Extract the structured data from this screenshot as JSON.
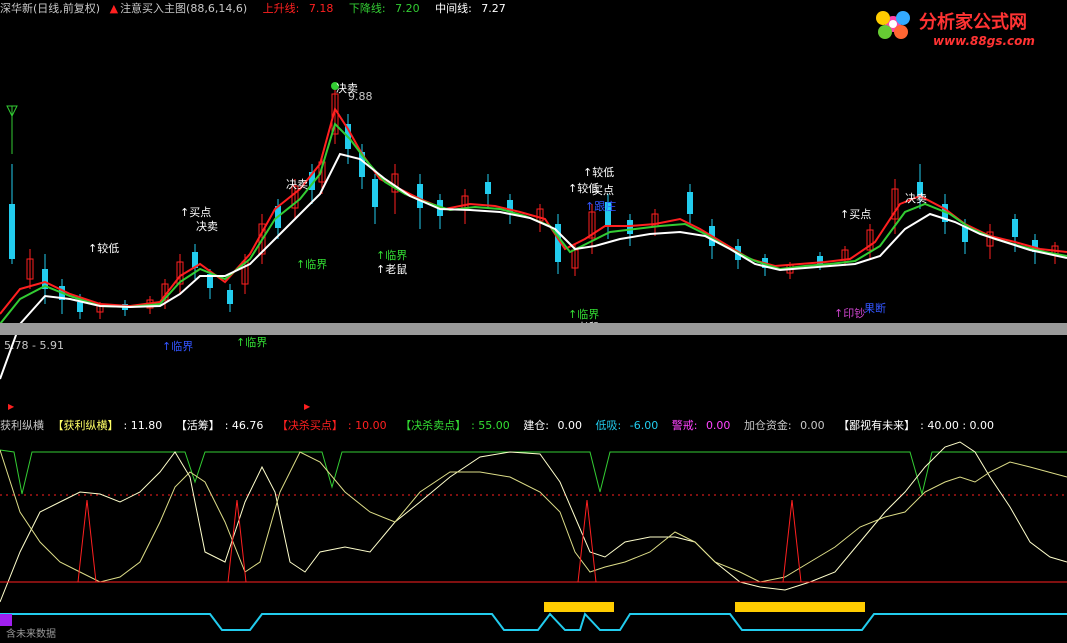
{
  "header": {
    "stock": "深华新(日线,前复权)",
    "indicator": "注意买入主图(88,6,14,6)",
    "up_label": "上升线:",
    "up_value": "7.18",
    "down_label": "下降线:",
    "down_value": "7.20",
    "mid_label": "中间线:",
    "mid_value": "7.27"
  },
  "logo": {
    "title": "分析家公式网",
    "url": "www.88gs.com"
  },
  "main_chart": {
    "price_high_label": "9.88",
    "price_low_label": "5.78 - 5.91",
    "signals": [
      {
        "text": "↑较低",
        "color": "#ffffff"
      },
      {
        "text": "↑买点",
        "color": "#ffffff"
      },
      {
        "text": "决卖",
        "color": "#ffffff"
      },
      {
        "text": "↑临界",
        "color": "#33dd33"
      },
      {
        "text": "↑临界",
        "color": "#33dd33"
      },
      {
        "text": "↑临界",
        "color": "#33dd33"
      },
      {
        "text": "↑老鼠",
        "color": "#ffffff"
      },
      {
        "text": "↑临界",
        "color": "#33dd33"
      },
      {
        "text": "↑老鼠",
        "color": "#ffffff"
      },
      {
        "text": "↑较低",
        "color": "#ffffff"
      },
      {
        "text": "↑较低",
        "color": "#ffffff"
      },
      {
        "text": "买点",
        "color": "#ffffff"
      },
      {
        "text": "↑买点",
        "color": "#ffffff"
      },
      {
        "text": "↑印钞",
        "color": "#cc44cc"
      },
      {
        "text": "果断",
        "color": "#3355ff"
      },
      {
        "text": "决卖",
        "color": "#ffffff"
      },
      {
        "text": "决卖",
        "color": "#ffffff"
      },
      {
        "text": "↑跟庄",
        "color": "#3355ff"
      },
      {
        "text": "↑临界",
        "color": "#3355ff"
      },
      {
        "text": "决卖",
        "color": "#ffffff"
      }
    ]
  },
  "sub_header": {
    "name": "获利纵横",
    "item1_label": "【获利纵横】",
    "item1_value": ": 11.80",
    "item2_label": "【活筹】",
    "item2_value": ": 46.76",
    "item3_label": "【决杀买点】",
    "item3_value": ": 10.00",
    "item4_label": "【决杀卖点】",
    "item4_value": ": 55.00",
    "build_label": "建仓:",
    "build_value": "0.00",
    "low_label": "低吸:",
    "low_value": "-6.00",
    "warn_label": "警戒:",
    "warn_value": "0.00",
    "add_label": "加仓资金:",
    "add_value": "0.00",
    "contempt_label": "【鄙视有未来】",
    "contempt_value": ": 40.00 : 0.00"
  },
  "footer": {
    "label": "含未来数据"
  },
  "colors": {
    "background": "#000000",
    "up_candle": "#ff2020",
    "down_candle": "#22ccee",
    "white_line": "#ffffff",
    "green_line": "#33cc33",
    "red_line": "#ff2020",
    "yellow": "#ffd700",
    "divider": "#9a9a9a"
  }
}
